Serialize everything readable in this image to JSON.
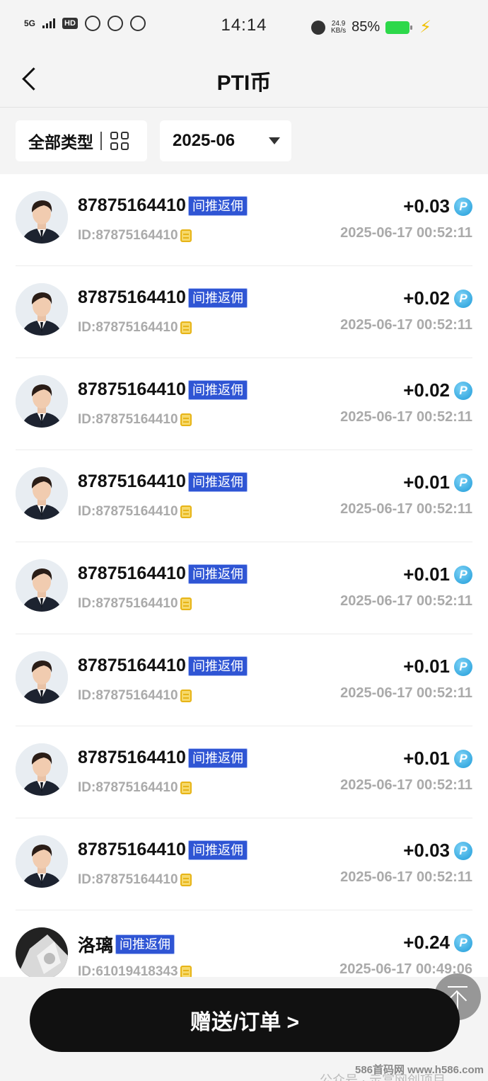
{
  "statusbar": {
    "network": "5G",
    "hd": "HD",
    "time": "14:14",
    "speed_value": "24.9",
    "speed_unit": "KB/s",
    "battery": "85%",
    "battery_color": "#2dd84a"
  },
  "navbar": {
    "title": "PTI币"
  },
  "filters": {
    "type_label": "全部类型",
    "date_label": "2025-06"
  },
  "records": [
    {
      "name": "87875164410",
      "tag": "间推返佣",
      "id": "ID:87875164410",
      "amount": "+0.03",
      "time": "2025-06-17 00:52:11",
      "coin": "P"
    },
    {
      "name": "87875164410",
      "tag": "间推返佣",
      "id": "ID:87875164410",
      "amount": "+0.02",
      "time": "2025-06-17 00:52:11",
      "coin": "P"
    },
    {
      "name": "87875164410",
      "tag": "间推返佣",
      "id": "ID:87875164410",
      "amount": "+0.02",
      "time": "2025-06-17 00:52:11",
      "coin": "P"
    },
    {
      "name": "87875164410",
      "tag": "间推返佣",
      "id": "ID:87875164410",
      "amount": "+0.01",
      "time": "2025-06-17 00:52:11",
      "coin": "P"
    },
    {
      "name": "87875164410",
      "tag": "间推返佣",
      "id": "ID:87875164410",
      "amount": "+0.01",
      "time": "2025-06-17 00:52:11",
      "coin": "P"
    },
    {
      "name": "87875164410",
      "tag": "间推返佣",
      "id": "ID:87875164410",
      "amount": "+0.01",
      "time": "2025-06-17 00:52:11",
      "coin": "P"
    },
    {
      "name": "87875164410",
      "tag": "间推返佣",
      "id": "ID:87875164410",
      "amount": "+0.01",
      "time": "2025-06-17 00:52:11",
      "coin": "P"
    },
    {
      "name": "87875164410",
      "tag": "间推返佣",
      "id": "ID:87875164410",
      "amount": "+0.03",
      "time": "2025-06-17 00:52:11",
      "coin": "P"
    },
    {
      "name": "洛璃",
      "tag": "间推返佣",
      "id": "ID:61019418343",
      "amount": "+0.24",
      "time": "2025-06-17 00:49:06",
      "coin": "P"
    }
  ],
  "bottom_button": {
    "label": "赠送/订单 >"
  },
  "watermark": {
    "site": "586首码网 www.h586.com",
    "account": "公众号 · 示富网创项目"
  },
  "colors": {
    "tag_bg": "#2f55d4",
    "coin": "#1e9bd8",
    "button_bg": "#111111"
  }
}
